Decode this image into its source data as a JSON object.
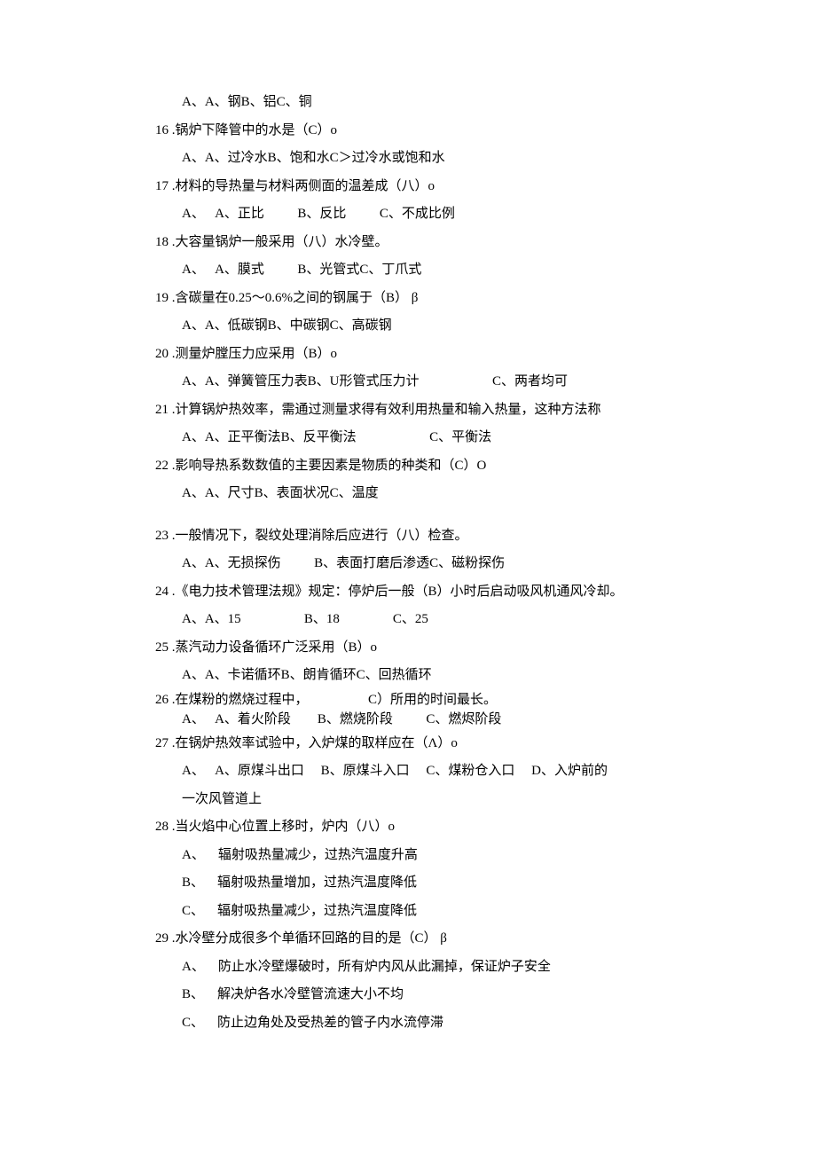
{
  "items": [
    {
      "q": "",
      "opts": [
        "A、A、钢B、铝C、铜"
      ]
    },
    {
      "num": "16",
      "q": ".锅炉下降管中的水是（C）o",
      "opts": [
        "A、A、过冷水B、饱和水C＞过冷水或饱和水"
      ]
    },
    {
      "num": "17",
      "q": ".材料的导热量与材料两侧面的温差成（八）o",
      "opts": [
        "A、   A、正比          B、反比          C、不成比例"
      ]
    },
    {
      "num": "18",
      "q": ".大容量锅炉一般采用（八）水冷壁。",
      "opts": [
        "A、   A、膜式          B、光管式C、丁爪式"
      ]
    },
    {
      "num": "19",
      "q": ".含碳量在0.25～0.6%之间的钢属于（B） β",
      "opts": [
        "A、A、低碳钢B、中碳钢C、高碳钢"
      ]
    },
    {
      "num": "20",
      "q": ".测量炉膛压力应采用（B）o",
      "opts": [
        "A、A、弹簧管压力表B、U形管式压力计                      C、两者均可"
      ]
    },
    {
      "num": "21",
      "q": ".计算锅炉热效率，需通过测量求得有效利用热量和输入热量，这种方法称",
      "opts": [
        "",
        "A、A、正平衡法B、反平衡法                      C、平衡法"
      ]
    },
    {
      "num": "22",
      "q": ".影响导热系数数值的主要因素是物质的种类和（C）O",
      "opts": [
        "A、A、尺寸B、表面状况C、温度"
      ]
    },
    {
      "gap": true
    },
    {
      "num": "23",
      "q": ".一般情况下，裂纹处理消除后应进行（八）检查。",
      "opts": [
        "A、A、无损探伤          B、表面打磨后渗透C、磁粉探伤"
      ]
    },
    {
      "num": "24",
      "q": ".《电力技术管理法规》规定：停炉后一般（B）小时后启动吸风机通风冷却。",
      "opts": [
        "A、A、15                   B、18                C、25"
      ]
    },
    {
      "num": "25",
      "q": ".蒸汽动力设备循环广泛采用（B）o",
      "opts": [
        "A、A、卡诺循环B、朗肯循环C、回热循环"
      ]
    },
    {
      "compact": true,
      "num": "26",
      "q": ".在煤粉的燃烧过程中，                  C）所用的时间最长。",
      "opts": [
        "A、   A、着火阶段        B、燃烧阶段          C、燃烬阶段"
      ]
    },
    {
      "num": "27",
      "q": ".在锅炉热效率试验中，入炉煤的取样应在（Λ）o",
      "opts": [
        "A、   A、原煤斗出口     B、原煤斗入口     C、煤粉仓入口     D、入炉前的",
        "一次风管道上"
      ]
    },
    {
      "num": "28",
      "q": ".当火焰中心位置上移时，炉内（八）o",
      "opts": [
        "A、    辐射吸热量减少，过热汽温度升高",
        "B、    辐射吸热量增加，过热汽温度降低",
        "C、    辐射吸热量减少，过热汽温度降低"
      ]
    },
    {
      "num": "29",
      "q": ".水冷壁分成很多个单循环回路的目的是（C） β",
      "opts": [
        "A、    防止水冷壁爆破时，所有炉内风从此漏掉，保证炉子安全",
        "B、    解决炉各水冷壁管流速大小不均",
        "C、    防止边角处及受热差的管子内水流停滞"
      ]
    }
  ]
}
